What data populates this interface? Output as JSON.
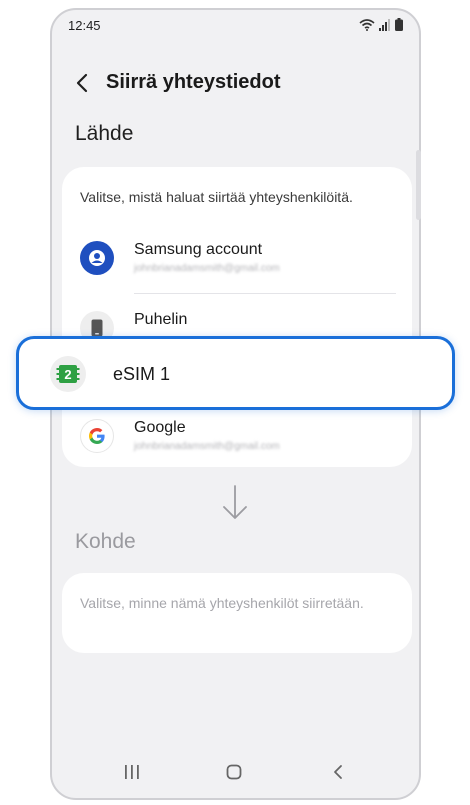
{
  "status_bar": {
    "time": "12:45",
    "icons": [
      "wifi-icon",
      "signal-icon",
      "battery-icon"
    ]
  },
  "app_bar": {
    "title": "Siirrä yhteystiedot",
    "back_icon": "chevron-left-icon"
  },
  "source": {
    "title": "Lähde",
    "description": "Valitse, mistä haluat siirtää yhteyshenkilöitä.",
    "items": [
      {
        "name": "Samsung account",
        "sub": "johnbrianadamsmith@gmail.com",
        "icon": "samsung-account-icon"
      },
      {
        "name": "Puhelin",
        "icon": "phone-device-icon"
      },
      {
        "name": "eSIM 1",
        "icon": "esim-icon",
        "badge": "2"
      },
      {
        "name": "Google",
        "sub": "johnbrianadamsmith@gmail.com",
        "icon": "google-icon"
      }
    ]
  },
  "destination": {
    "title": "Kohde",
    "description": "Valitse, minne nämä yhteyshenkilöt siirretään."
  },
  "colors": {
    "accent": "#1a6fd9",
    "samsung_icon": "#1f4fbf",
    "esim_green": "#2ea043",
    "background": "#f1f1f3"
  },
  "nav_bar": {
    "icons": [
      "recents-icon",
      "home-icon",
      "back-icon"
    ]
  }
}
